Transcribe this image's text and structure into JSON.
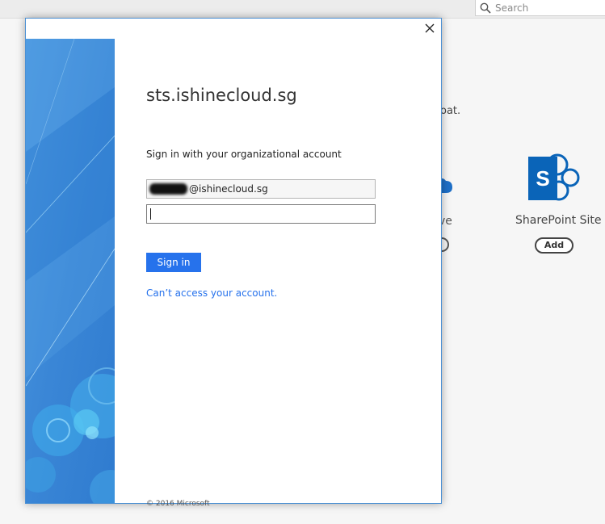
{
  "background": {
    "search": {
      "placeholder": "Search",
      "icon": "search-icon"
    },
    "partial_text": "oat.",
    "apps": [
      {
        "label_partial": "ve",
        "icon": "onedrive-cloud-icon"
      },
      {
        "label": "SharePoint Site",
        "add_label": "Add",
        "icon": "sharepoint-icon"
      }
    ]
  },
  "dialog": {
    "close_icon": "close-icon",
    "domain": "sts.ishinecloud.sg",
    "instruction": "Sign in with your organizational account",
    "username_suffix": "@ishinecloud.sg",
    "password_value": "",
    "signin_label": "Sign in",
    "cant_access_label": "Can’t access your account.",
    "copyright": "© 2016 Microsoft"
  },
  "colors": {
    "accent": "#2672ec",
    "panel_blue": "#3b87d6",
    "dialog_border": "#4a8fd3"
  }
}
